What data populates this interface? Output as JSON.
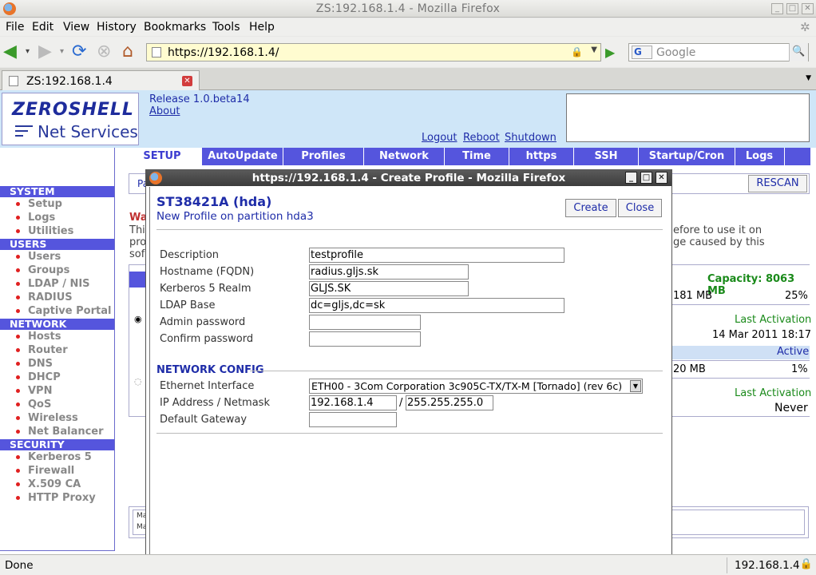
{
  "window": {
    "title": "ZS:192.168.1.4 - Mozilla Firefox"
  },
  "menu": [
    "File",
    "Edit",
    "View",
    "History",
    "Bookmarks",
    "Tools",
    "Help"
  ],
  "nav": {
    "url": "https://192.168.1.4/",
    "search_placeholder": "Google",
    "search_engine": "G"
  },
  "tab": {
    "title": "ZS:192.168.1.4"
  },
  "header": {
    "logo_top": "ZEROSHELL",
    "logo_bottom": "Net Services",
    "release": "Release 1.0.beta14",
    "about": "About",
    "logout": "Logout",
    "reboot": "Reboot",
    "shutdown": "Shutdown"
  },
  "sidebar": {
    "system": "SYSTEM",
    "system_items": [
      "Setup",
      "Logs",
      "Utilities"
    ],
    "users": "USERS",
    "users_items": [
      "Users",
      "Groups",
      "LDAP / NIS",
      "RADIUS",
      "Captive Portal"
    ],
    "network": "NETWORK",
    "network_items": [
      "Hosts",
      "Router",
      "DNS",
      "DHCP",
      "VPN",
      "QoS",
      "Wireless",
      "Net Balancer"
    ],
    "security": "SECURITY",
    "security_items": [
      "Kerberos 5",
      "Firewall",
      "X.509 CA",
      "HTTP Proxy"
    ]
  },
  "topnav": [
    "SETUP",
    "AutoUpdate",
    "Profiles",
    "Network",
    "Time",
    "https",
    "SSH",
    "Startup/Cron",
    "Logs"
  ],
  "main": {
    "rescan": "RESCAN",
    "pa": "Pa",
    "warn": "Wa",
    "this": "This",
    "pro": "pro",
    "sof": "sof",
    "right_text_1": "efore to use it on",
    "right_text_2": "ge caused by this",
    "capacity": "Capacity: 8063 MB",
    "row1_size": "181 MB",
    "row1_pct": "25%",
    "last_activation": "Last Activation",
    "row1_date": "14 Mar 2011 18:17",
    "active": "Active",
    "row2_size": "20 MB",
    "row2_pct": "1%",
    "row2_last": "Never",
    "ma1": "Ma",
    "ma2": "Ma"
  },
  "popup": {
    "title": "https://192.168.1.4 - Create Profile - Mozilla Firefox",
    "heading": "ST38421A (hda)",
    "subheading": "New Profile on partition hda3",
    "create": "Create",
    "close": "Close",
    "labels": {
      "description": "Description",
      "hostname": "Hostname (FQDN)",
      "realm": "Kerberos 5 Realm",
      "ldap_base": "LDAP Base",
      "admin_password": "Admin password",
      "confirm_password": "Confirm password",
      "network_config": "NETWORK CONFIG",
      "ethernet": "Ethernet Interface",
      "ip_netmask": "IP Address / Netmask",
      "gateway": "Default Gateway"
    },
    "values": {
      "description": "testprofile",
      "hostname": "radius.gljs.sk",
      "realm": "GLJS.SK",
      "ldap_base": "dc=gljs,dc=sk",
      "admin_password": "",
      "confirm_password": "",
      "ethernet": "ETH00 - 3Com Corporation 3c905C-TX/TX-M [Tornado] (rev 6c)",
      "ip": "192.168.1.4",
      "netmask": "255.255.255.0",
      "gateway": ""
    },
    "slash": "/"
  },
  "statusbar": {
    "left": "Done",
    "right": "192.168.1.4"
  }
}
